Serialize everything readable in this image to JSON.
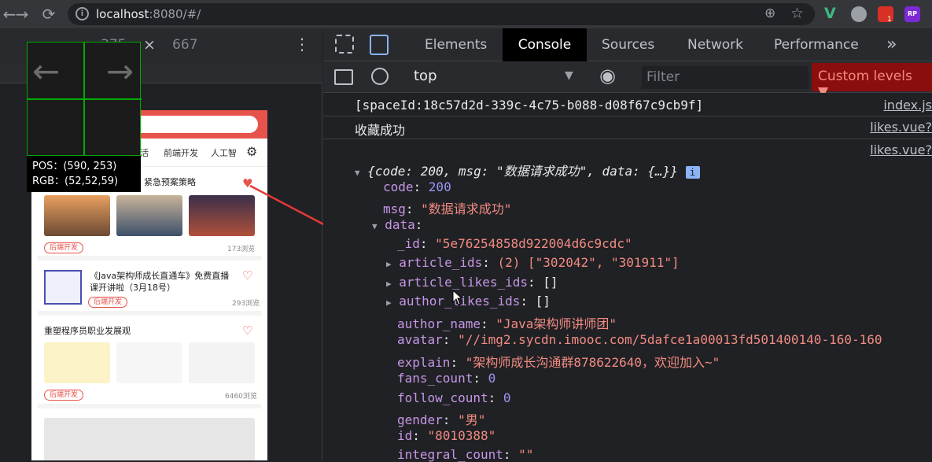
{
  "browser": {
    "url_host": "localhost",
    "url_rest": ":8080/#/",
    "icons": [
      "back-arrow-icon",
      "forward-arrow-icon",
      "reload-icon",
      "info-icon",
      "zoom-icon",
      "star-icon",
      "vue-devtools-icon",
      "extension-icon",
      "notification-icon",
      "rp-icon"
    ],
    "badge": "1",
    "rp_label": "RP"
  },
  "device": {
    "width": "375",
    "height": "667",
    "close": "×",
    "menu": "⋮"
  },
  "magnifier": {
    "pos": "POS：(590, 253)",
    "rgb": "RGB：(52,52,59)"
  },
  "app": {
    "categories": [
      "活",
      "前端开发",
      "人工智"
    ],
    "articles": [
      {
        "title": "紧急预案策略",
        "tag": "后端开发",
        "views": "173浏览"
      },
      {
        "title": "《Java架构师成长直通车》免费直播课开讲啦（3月18号）",
        "tag": "后端开发",
        "views": "293浏览"
      },
      {
        "title": "重塑程序员职业发展观",
        "tag": "后端开发",
        "views": "6460浏览"
      }
    ]
  },
  "devtools": {
    "tabs": [
      "Elements",
      "Console",
      "Sources",
      "Network",
      "Performance"
    ],
    "more": "»",
    "context": "top",
    "filter_placeholder": "Filter",
    "levels": "Custom levels ▼",
    "console_lines": {
      "l1": "[spaceId:18c57d2d-339c-4c75-b088-d08f67c9cb9f]",
      "l1_src": "index.js",
      "l2": "收藏成功",
      "l2_src": "likes.vue?",
      "l3_src": "likes.vue?",
      "summary": "{code: 200, msg: \"数据请求成功\", data: {…}}",
      "info": "i"
    },
    "object": {
      "code": "200",
      "msg": "\"数据请求成功\"",
      "data_label": "data",
      "_id": "\"5e76254858d922004d6c9cdc\"",
      "article_ids": "(2) [\"302042\", \"301911\"]",
      "article_likes_ids": "[]",
      "author_likes_ids": "[]",
      "author_name": "\"Java架构师讲师团\"",
      "avatar": "\"//img2.sycdn.imooc.com/5dafce1a00013fd501400140-160-160",
      "explain": "\"架构师成长沟通群878622640，欢迎加入~\"",
      "fans_count": "0",
      "follow_count": "0",
      "gender": "\"男\"",
      "id": "\"8010388\"",
      "integral_count": "\"\""
    }
  }
}
